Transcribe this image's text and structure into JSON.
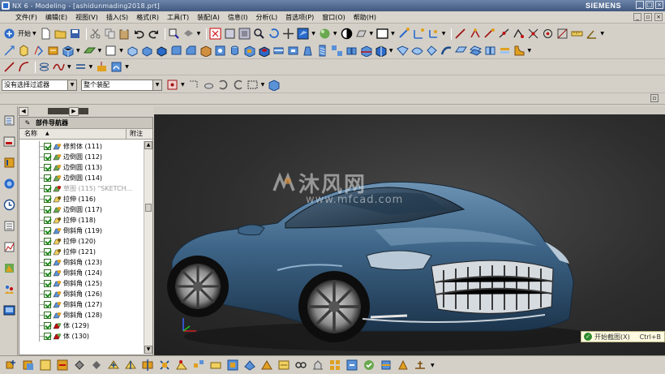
{
  "window": {
    "title": "NX 6 - Modeling - [ashidunmading2018.prt]",
    "brand": "SIEMENS"
  },
  "menu": {
    "items": [
      "文件(F)",
      "编辑(E)",
      "视图(V)",
      "插入(S)",
      "格式(R)",
      "工具(T)",
      "装配(A)",
      "信息(I)",
      "分析(L)",
      "首选项(P)",
      "窗口(O)",
      "帮助(H)"
    ]
  },
  "toolbar": {
    "start_label": "开始"
  },
  "selection_bar": {
    "filter_value": "没有选择过滤器",
    "scope_value": "整个装配"
  },
  "navigator": {
    "title": "部件导航器",
    "col_name": "名称",
    "col_note": "附注",
    "items": [
      {
        "label": "修剪体 (111)",
        "icon": "trim-icon"
      },
      {
        "label": "边倒圆 (112)",
        "icon": "edge-blend-icon"
      },
      {
        "label": "边倒圆 (113)",
        "icon": "edge-blend-icon"
      },
      {
        "label": "边倒圆 (114)",
        "icon": "edge-blend-icon"
      },
      {
        "label": "草图 (115) \"SKETCH...",
        "icon": "sketch-icon",
        "dim": true
      },
      {
        "label": "拉伸 (116)",
        "icon": "extrude-icon"
      },
      {
        "label": "边倒圆 (117)",
        "icon": "edge-blend-icon"
      },
      {
        "label": "拉伸 (118)",
        "icon": "extrude-icon"
      },
      {
        "label": "倒斜角 (119)",
        "icon": "chamfer-icon"
      },
      {
        "label": "拉伸 (120)",
        "icon": "extrude-icon"
      },
      {
        "label": "拉伸 (121)",
        "icon": "extrude-icon"
      },
      {
        "label": "倒斜角 (123)",
        "icon": "chamfer-icon"
      },
      {
        "label": "倒斜角 (124)",
        "icon": "chamfer-icon"
      },
      {
        "label": "倒斜角 (125)",
        "icon": "chamfer-icon"
      },
      {
        "label": "倒斜角 (126)",
        "icon": "chamfer-icon"
      },
      {
        "label": "倒斜角 (127)",
        "icon": "chamfer-icon"
      },
      {
        "label": "倒斜角 (128)",
        "icon": "chamfer-icon"
      },
      {
        "label": "体 (129)",
        "icon": "body-icon"
      },
      {
        "label": "体 (130)",
        "icon": "body-icon"
      }
    ]
  },
  "viewport": {
    "watermark_text": "沐风网",
    "watermark_url": "www.mfcad.com"
  },
  "toast": {
    "label": "开始截图(X)",
    "shortcut": "Ctrl+B"
  }
}
